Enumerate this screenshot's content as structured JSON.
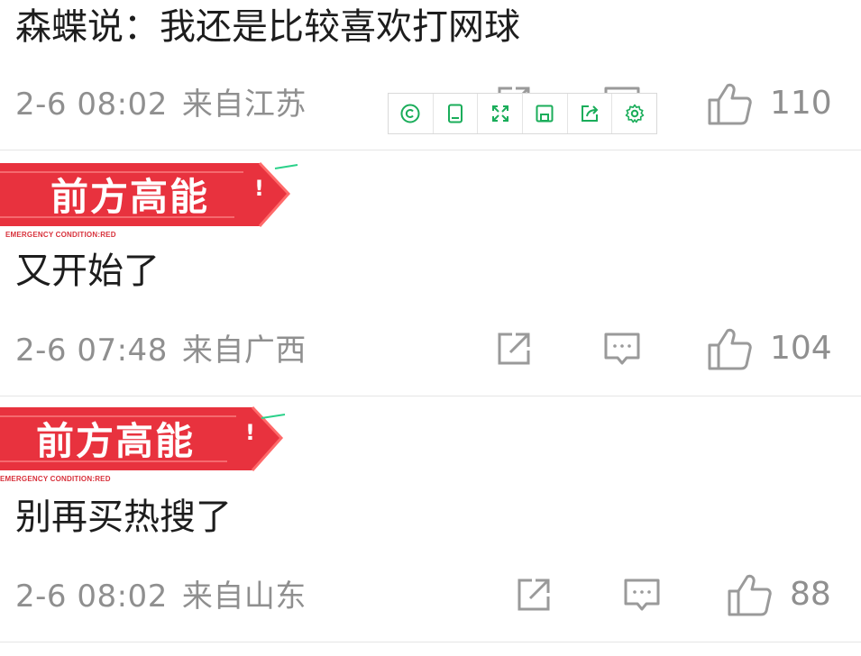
{
  "comments": [
    {
      "text": "森蝶说：我还是比较喜欢打网球",
      "date": "2-6 08:02",
      "location": "来自江苏",
      "likes": "110"
    },
    {
      "badge": {
        "title": "前方高能",
        "exclaim": "!",
        "subtitle": "EMERGENCY  CONDITION:RED"
      },
      "text": "又开始了",
      "date": "2-6 07:48",
      "location": "来自广西",
      "likes": "104"
    },
    {
      "badge": {
        "title": "前方高能",
        "exclaim": "!",
        "subtitle": "EMERGENCY  CONDITION:RED"
      },
      "text": "别再买热搜了",
      "date": "2-6 08:02",
      "location": "来自山东",
      "likes": "88"
    }
  ],
  "toolbar": {
    "buttons": [
      "copyright-icon",
      "tablet-icon",
      "expand-icon",
      "save-icon",
      "share-icon",
      "settings-icon"
    ]
  },
  "colors": {
    "meta_gray": "#8f8f8f",
    "badge_red": "#e8323e",
    "toolbar_green": "#1aad5a"
  }
}
